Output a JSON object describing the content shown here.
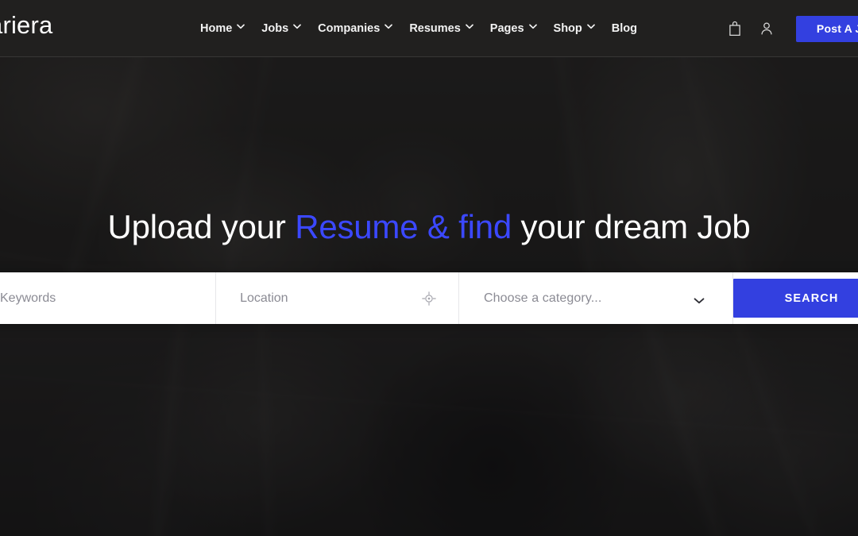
{
  "site": {
    "logo_text": "ariera"
  },
  "header": {
    "nav": [
      {
        "label": "Home",
        "has_dropdown": true,
        "icon": "chevron-down-icon"
      },
      {
        "label": "Jobs",
        "has_dropdown": true,
        "icon": "chevron-down-icon"
      },
      {
        "label": "Companies",
        "has_dropdown": true,
        "icon": "chevron-down-icon"
      },
      {
        "label": "Resumes",
        "has_dropdown": true,
        "icon": "chevron-down-icon"
      },
      {
        "label": "Pages",
        "has_dropdown": true,
        "icon": "chevron-down-icon"
      },
      {
        "label": "Shop",
        "has_dropdown": true,
        "icon": "chevron-down-icon"
      },
      {
        "label": "Blog",
        "has_dropdown": false,
        "icon": ""
      }
    ],
    "cart_icon": "shopping-bag-icon",
    "account_icon": "user-account-icon",
    "post_job_label": "Post A Job"
  },
  "hero": {
    "heading_part1": "Upload your ",
    "heading_accent": "Resume & find",
    "heading_part2": " your dream Job"
  },
  "search": {
    "keywords_placeholder": "Keywords",
    "keywords_value": "",
    "location_placeholder": "Location",
    "location_value": "",
    "geolocate_icon": "crosshair-locate-icon",
    "category_placeholder": "Choose a category...",
    "category_selected": "Choose a category...",
    "category_chevron_icon": "chevron-down-icon",
    "search_button_label": "SEARCH"
  },
  "colors": {
    "accent_blue": "#3340e0",
    "heading_accent_blue": "#3b48ff",
    "header_bg": "#222120",
    "search_bar_bg": "#ffffff",
    "placeholder_grey": "#8b8b94"
  }
}
